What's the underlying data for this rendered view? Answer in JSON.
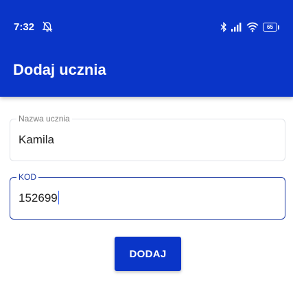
{
  "status_bar": {
    "time": "7:32",
    "battery_level": "65",
    "icons": [
      "alarm-off-icon",
      "bluetooth-icon",
      "signal-icon",
      "wifi-icon",
      "battery-icon"
    ]
  },
  "app_bar": {
    "title": "Dodaj ucznia"
  },
  "form": {
    "student_name": {
      "label": "Nazwa ucznia",
      "value": "Kamila"
    },
    "code": {
      "label": "KOD",
      "value": "152699"
    },
    "submit_label": "DODAJ"
  },
  "colors": {
    "primary": "#0a35c8",
    "focused_border": "#1c3aa3",
    "idle_border": "#e0e3e8",
    "caret": "#3f6dff"
  }
}
